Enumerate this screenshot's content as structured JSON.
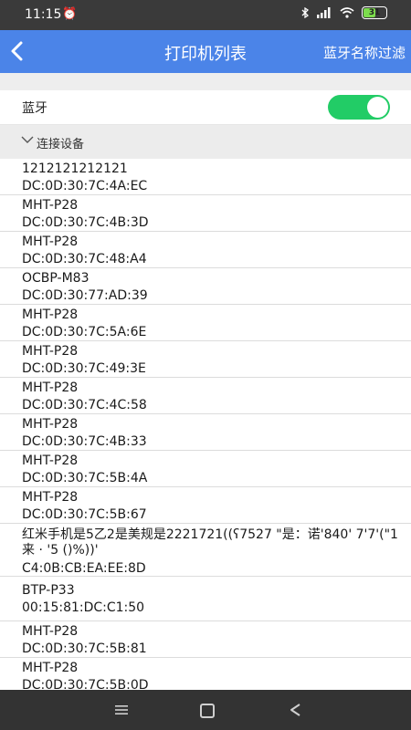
{
  "status": {
    "time": "11:15",
    "battery": "31"
  },
  "header": {
    "title": "打印机列表",
    "filter_label": "蓝牙名称过滤"
  },
  "bluetooth": {
    "label": "蓝牙",
    "enabled": true
  },
  "section": {
    "label": "连接设备"
  },
  "devices": [
    {
      "name": "1212121212121",
      "mac": "DC:0D:30:7C:4A:EC"
    },
    {
      "name": "MHT-P28",
      "mac": "DC:0D:30:7C:4B:3D"
    },
    {
      "name": "MHT-P28",
      "mac": "DC:0D:30:7C:48:A4"
    },
    {
      "name": "OCBP-M83",
      "mac": "DC:0D:30:77:AD:39"
    },
    {
      "name": "MHT-P28",
      "mac": "DC:0D:30:7C:5A:6E"
    },
    {
      "name": "MHT-P28",
      "mac": "DC:0D:30:7C:49:3E"
    },
    {
      "name": "MHT-P28",
      "mac": "DC:0D:30:7C:4C:58"
    },
    {
      "name": "MHT-P28",
      "mac": "DC:0D:30:7C:4B:33"
    },
    {
      "name": "MHT-P28",
      "mac": "DC:0D:30:7C:5B:4A"
    },
    {
      "name": "MHT-P28",
      "mac": "DC:0D:30:7C:5B:67"
    },
    {
      "name": "红米手机是5乙2是美规是2221721((ʕ7527 \"是：诺'840' 7'7'(\"1 来 · '5 ()%))'",
      "mac": "C4:0B:CB:EA:EE:8D"
    },
    {
      "name": "BTP-P33",
      "mac": "00:15:81:DC:C1:50"
    },
    {
      "name": "MHT-P28",
      "mac": "DC:0D:30:7C:5B:81"
    },
    {
      "name": "MHT-P28",
      "mac": "DC:0D:30:7C:5B:0D"
    }
  ]
}
